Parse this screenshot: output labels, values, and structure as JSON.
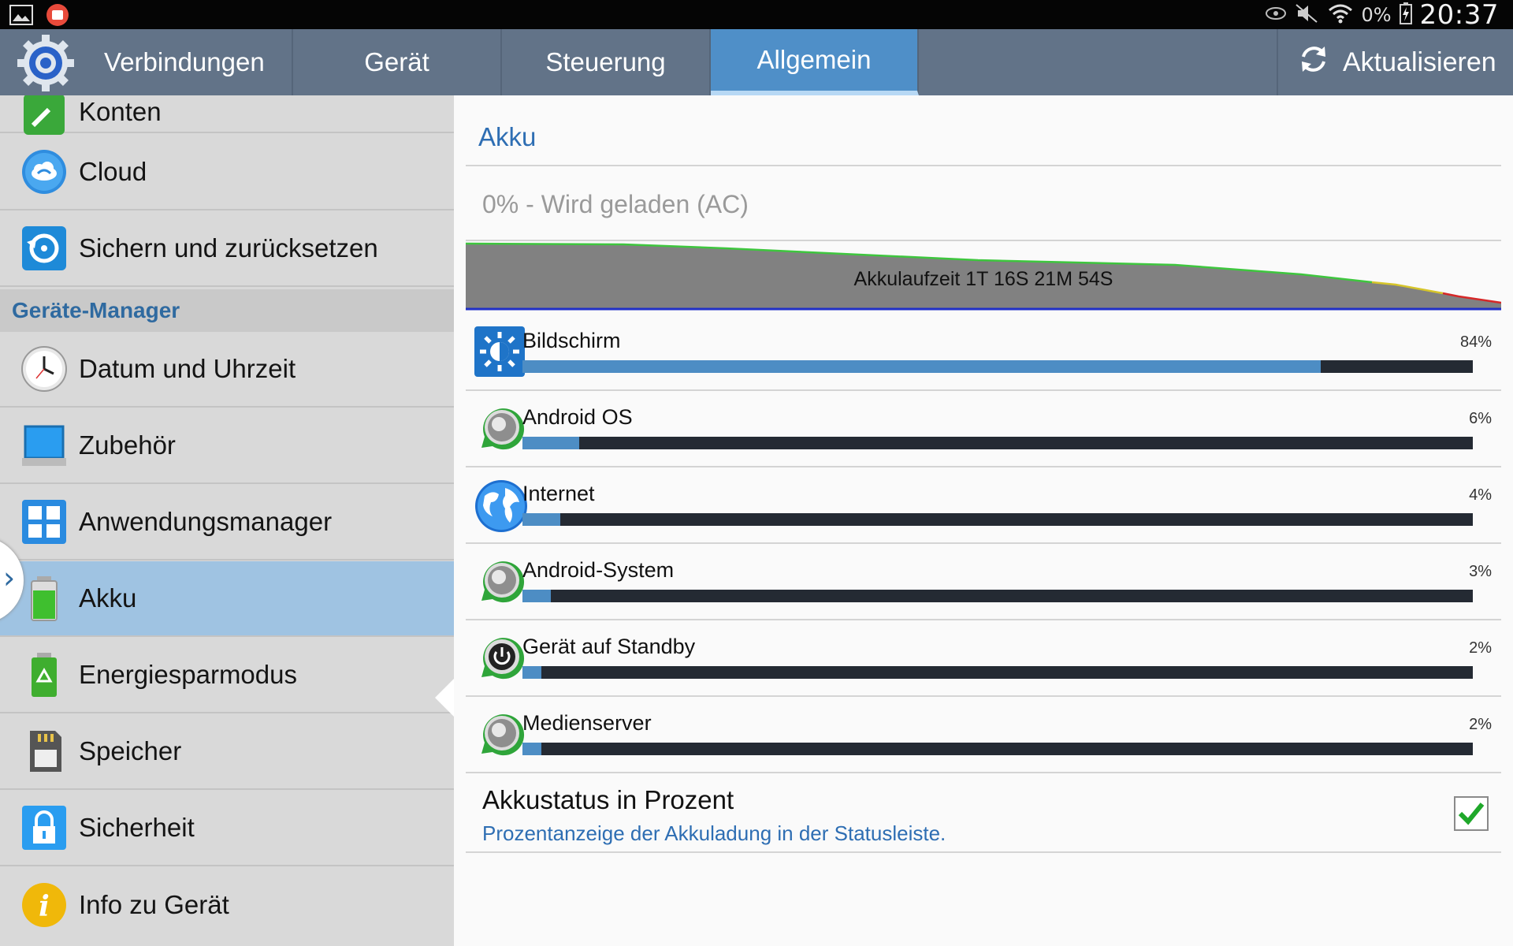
{
  "status_bar": {
    "battery_pct": "0%",
    "time": "20:37"
  },
  "tabs": [
    {
      "label": "Verbindungen"
    },
    {
      "label": "Gerät"
    },
    {
      "label": "Steuerung"
    },
    {
      "label": "Allgemein",
      "active": true
    }
  ],
  "refresh_label": "Aktualisieren",
  "sidebar": {
    "partial_item": "Konten",
    "items": [
      {
        "label": "Cloud",
        "icon": "cloud-icon"
      },
      {
        "label": "Sichern und zurücksetzen",
        "icon": "backup-icon"
      }
    ],
    "section_header": "Geräte-Manager",
    "items2": [
      {
        "label": "Datum und Uhrzeit",
        "icon": "clock-icon"
      },
      {
        "label": "Zubehör",
        "icon": "accessory-icon"
      },
      {
        "label": "Anwendungsmanager",
        "icon": "apps-icon"
      },
      {
        "label": "Akku",
        "icon": "battery-icon",
        "selected": true
      },
      {
        "label": "Energiesparmodus",
        "icon": "power-saving-icon"
      },
      {
        "label": "Speicher",
        "icon": "sd-card-icon"
      },
      {
        "label": "Sicherheit",
        "icon": "lock-icon"
      },
      {
        "label": "Info zu Gerät",
        "icon": "info-icon"
      }
    ]
  },
  "main": {
    "title": "Akku",
    "charge_status": "0% - Wird geladen (AC)",
    "graph_label": "Akkulaufzeit 1T 16S 21M 54S",
    "usage": [
      {
        "name": "Bildschirm",
        "pct_label": "84%",
        "pct": 84,
        "icon": "brightness-icon"
      },
      {
        "name": "Android OS",
        "pct_label": "6%",
        "pct": 6,
        "icon": "android-os-icon"
      },
      {
        "name": "Internet",
        "pct_label": "4%",
        "pct": 4,
        "icon": "globe-icon"
      },
      {
        "name": "Android-System",
        "pct_label": "3%",
        "pct": 3,
        "icon": "android-system-icon"
      },
      {
        "name": "Gerät auf Standby",
        "pct_label": "2%",
        "pct": 2,
        "icon": "standby-icon"
      },
      {
        "name": "Medienserver",
        "pct_label": "2%",
        "pct": 2,
        "icon": "media-server-icon"
      }
    ],
    "percent_setting": {
      "title": "Akkustatus in Prozent",
      "subtitle": "Prozentanzeige der Akkuladung in der Statusleiste.",
      "checked": true
    }
  },
  "colors": {
    "accent": "#4f8fc8",
    "tabbar": "#627388",
    "selected_item": "#9fc3e2",
    "bar_fill": "#4d8dc4",
    "bar_track": "#242a33"
  }
}
